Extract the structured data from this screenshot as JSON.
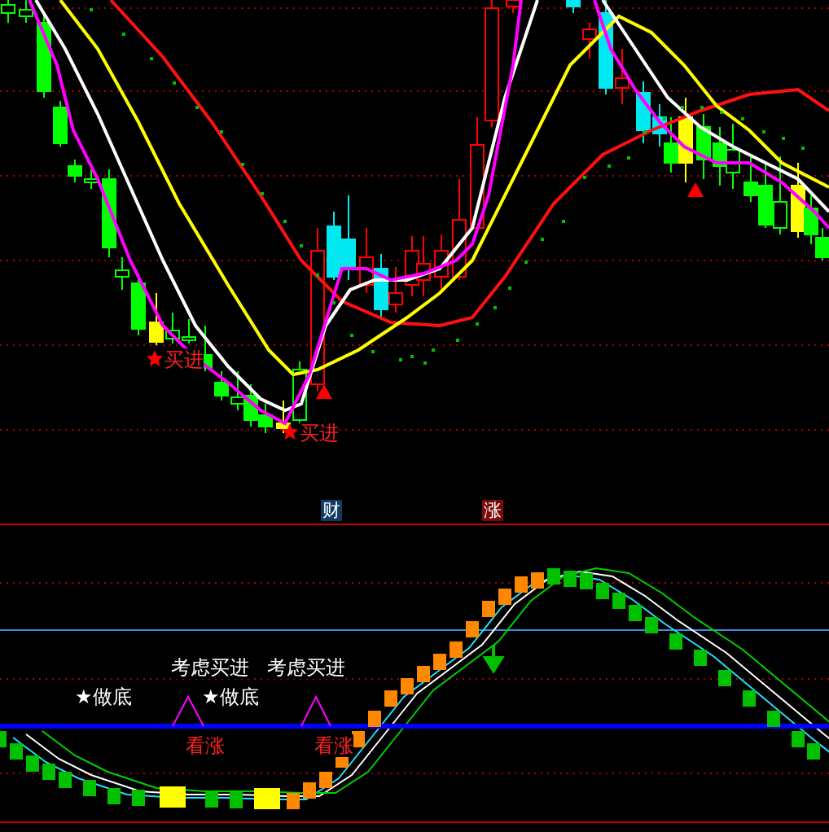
{
  "price_panel": {
    "signals": [
      {
        "label": "买进"
      },
      {
        "label": "买进"
      }
    ]
  },
  "indicator_panel": {
    "badges": [
      {
        "label": "财",
        "color": "#143a66"
      },
      {
        "label": "涨",
        "color": "#7a0a0a"
      }
    ],
    "annotations": [
      {
        "kind": "bottom",
        "text": "★做底"
      },
      {
        "kind": "consider",
        "text": "考虑买进"
      },
      {
        "kind": "bottom",
        "text": "★做底"
      },
      {
        "kind": "consider",
        "text": "考虑买进"
      },
      {
        "kind": "bullish",
        "text": "看涨"
      },
      {
        "kind": "bullish",
        "text": "看涨"
      }
    ]
  }
}
